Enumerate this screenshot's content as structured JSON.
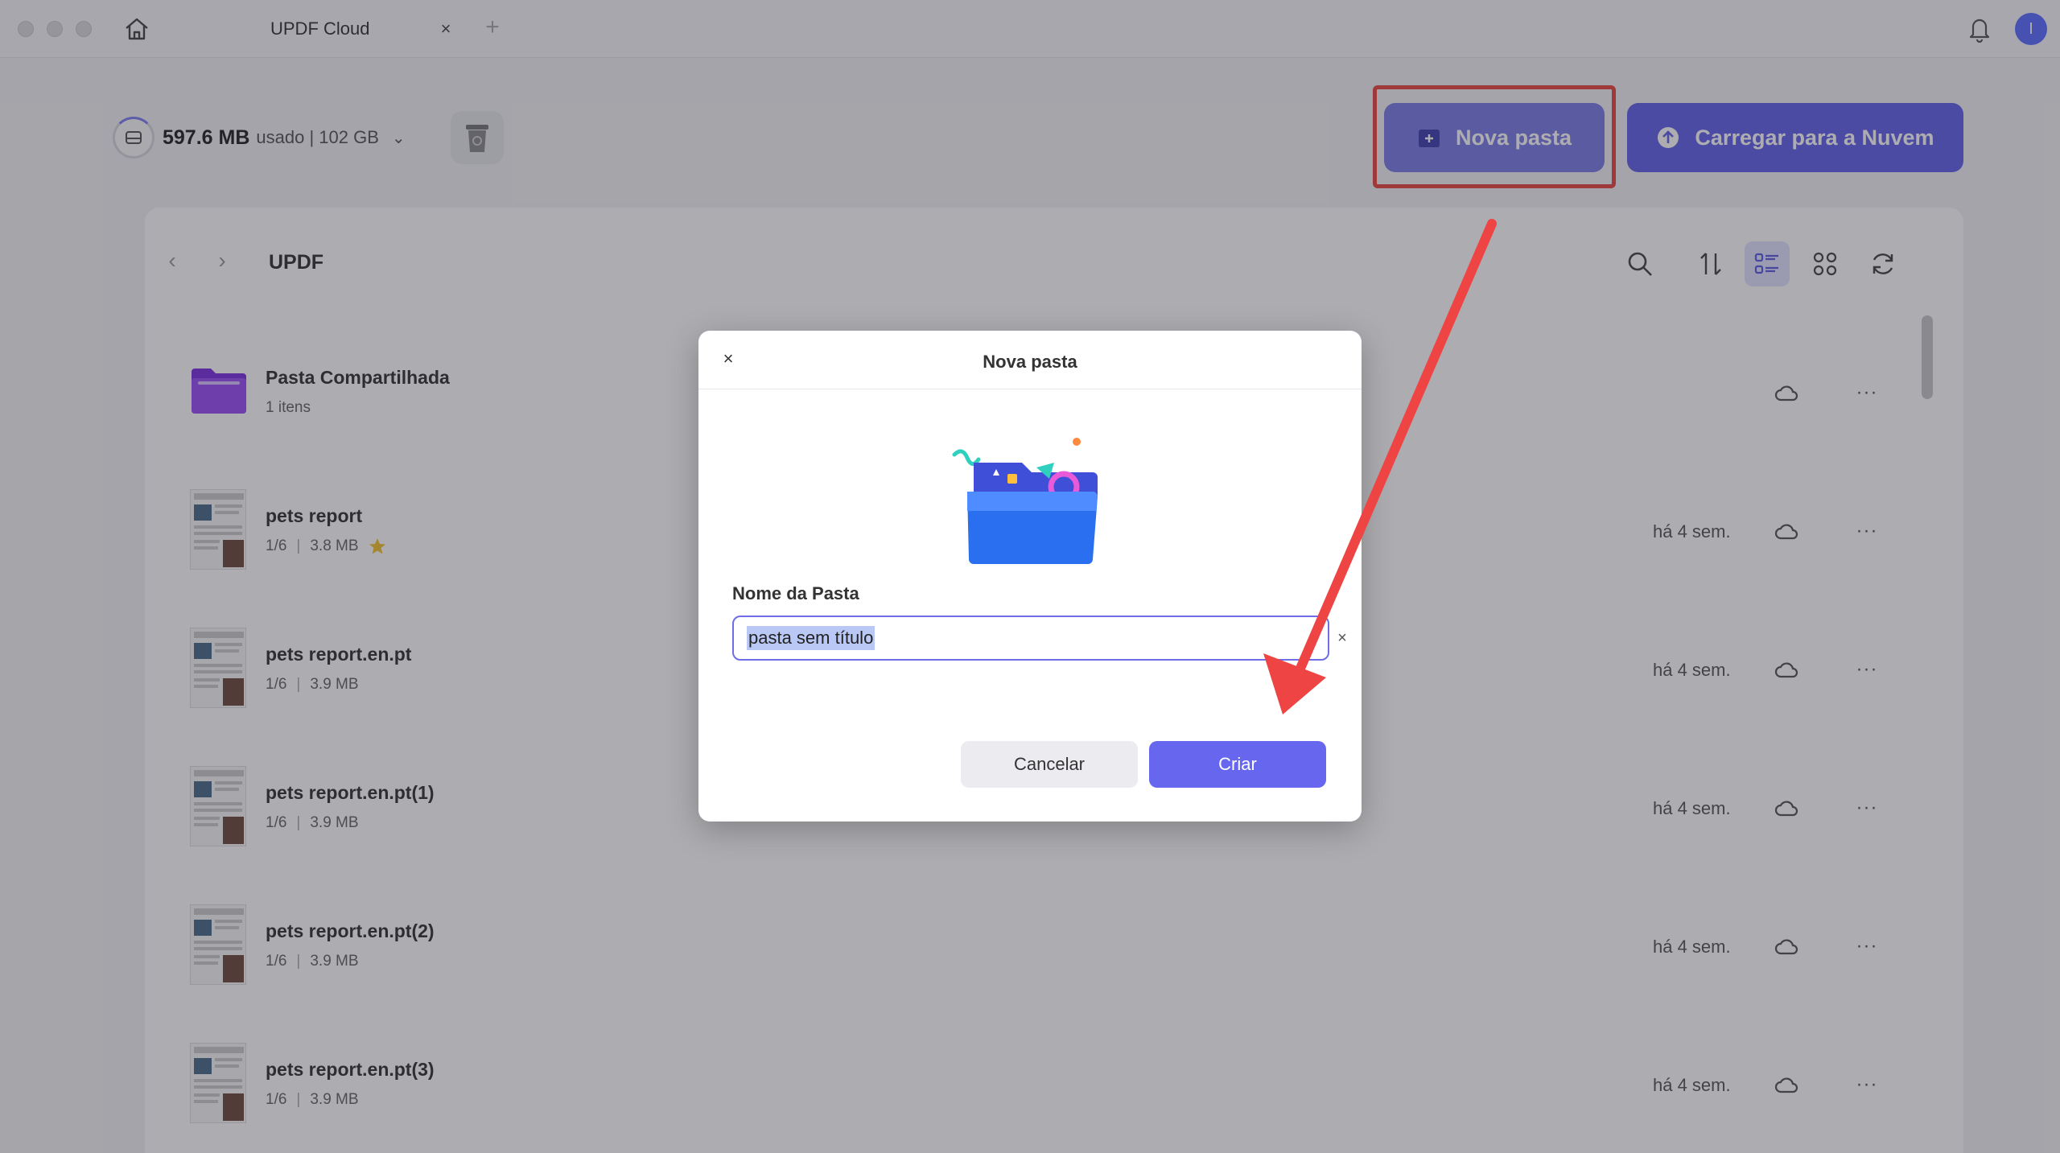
{
  "window": {
    "tab_title": "UPDF Cloud",
    "tab_close": "×",
    "tab_add": "+",
    "avatar_initial": "I"
  },
  "toolbar": {
    "storage_used": "597.6 MB",
    "storage_total": "usado | 102 GB",
    "storage_chevron": "⌄",
    "new_folder_label": "Nova pasta",
    "upload_label": "Carregar para a Nuvem"
  },
  "browser": {
    "back": "‹",
    "forward": "›",
    "breadcrumb": "UPDF",
    "rows": [
      {
        "name": "Pasta Compartilhada",
        "meta1": "1 itens",
        "meta2": "",
        "time": "",
        "type": "folder",
        "starred": false
      },
      {
        "name": "pets report",
        "meta1": "1/6",
        "meta2": "3.8 MB",
        "time": "há 4 sem.",
        "type": "pdf",
        "starred": true
      },
      {
        "name": "pets report.en.pt",
        "meta1": "1/6",
        "meta2": "3.9 MB",
        "time": "há 4 sem.",
        "type": "pdf",
        "starred": false
      },
      {
        "name": "pets report.en.pt(1)",
        "meta1": "1/6",
        "meta2": "3.9 MB",
        "time": "há 4 sem.",
        "type": "pdf",
        "starred": false
      },
      {
        "name": "pets report.en.pt(2)",
        "meta1": "1/6",
        "meta2": "3.9 MB",
        "time": "há 4 sem.",
        "type": "pdf",
        "starred": false
      },
      {
        "name": "pets report.en.pt(3)",
        "meta1": "1/6",
        "meta2": "3.9 MB",
        "time": "há 4 sem.",
        "type": "pdf",
        "starred": false
      }
    ],
    "more_glyph": "···",
    "meta_separator": "|"
  },
  "dialog": {
    "title": "Nova pasta",
    "close": "×",
    "field_label": "Nome da Pasta",
    "field_value": "pasta sem título",
    "clear": "×",
    "cancel_label": "Cancelar",
    "create_label": "Criar"
  },
  "colors": {
    "accent": "#6666ee",
    "highlight": "#e8443f",
    "folder": "#8a3ff0"
  }
}
